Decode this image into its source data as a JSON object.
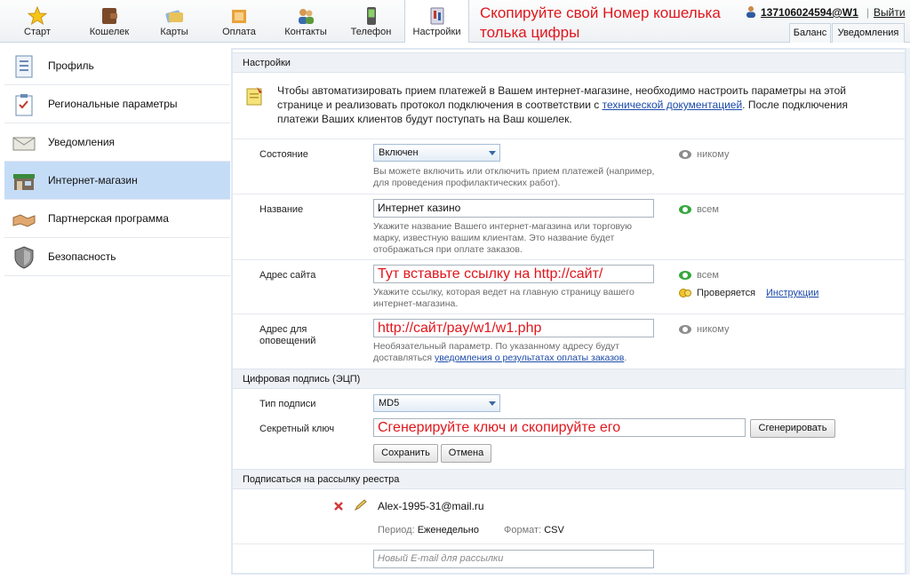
{
  "nav": {
    "tabs": [
      {
        "label": "Старт",
        "icon": "star-icon"
      },
      {
        "label": "Кошелек",
        "icon": "wallet-icon"
      },
      {
        "label": "Карты",
        "icon": "cards-icon"
      },
      {
        "label": "Оплата",
        "icon": "payment-icon"
      },
      {
        "label": "Контакты",
        "icon": "contacts-icon"
      },
      {
        "label": "Телефон",
        "icon": "phone-icon"
      },
      {
        "label": "Настройки",
        "icon": "settings-icon"
      }
    ],
    "active_tab": "Настройки"
  },
  "annotations": {
    "top_line1": "Скопируйте свой Номер кошелька",
    "top_line2": "толька цифры"
  },
  "account": {
    "id": "137106024594@W1",
    "separator": "|",
    "logout": "Выйти",
    "balance_tab": "Баланс",
    "notifications_tab": "Уведомления"
  },
  "sidebar": {
    "items": [
      {
        "label": "Профиль",
        "icon": "profile-icon"
      },
      {
        "label": "Региональные параметры",
        "icon": "regional-icon"
      },
      {
        "label": "Уведомления",
        "icon": "notifications-icon"
      },
      {
        "label": "Интернет-магазин",
        "icon": "shop-icon"
      },
      {
        "label": "Партнерская программа",
        "icon": "handshake-icon"
      },
      {
        "label": "Безопасность",
        "icon": "shield-icon"
      }
    ],
    "active": "Интернет-магазин"
  },
  "settings": {
    "header": "Настройки",
    "intro_part1": "Чтобы автоматизировать прием платежей в Вашем интернет-магазине, необходимо настроить параметры на этой странице и реализовать протокол подключения в соответствии с ",
    "intro_link": "технической документацией",
    "intro_part2": ". После подключения платежи Ваших клиентов будут поступать на Ваш кошелек.",
    "state": {
      "label": "Состояние",
      "value": "Включен",
      "hint": "Вы можете включить или отключить прием платежей (например, для проведения профилактических работ).",
      "visibility": "никому"
    },
    "name": {
      "label": "Название",
      "value": "Интернет казино",
      "hint": "Укажите название Вашего интернет-магазина или торговую марку, известную вашим клиентам. Это название будет отображаться при оплате заказов.",
      "visibility": "всем"
    },
    "site": {
      "label": "Адрес сайта",
      "value": "Тут вставьте ссылку на http://сайт/",
      "hint": "Укажите ссылку, которая ведет на главную страницу вашего интернет-магазина.",
      "visibility": "всем",
      "status": "Проверяется",
      "instructions": "Инструкции"
    },
    "notify": {
      "label_line1": "Адрес для",
      "label_line2": "оповещений",
      "value": "http://сайт/pay/w1/w1.php",
      "hint_part1": "Необязательный параметр. По указанному адресу будут доставляться ",
      "hint_link": "уведомления о результатах оплаты заказов",
      "hint_part2": ".",
      "visibility": "никому"
    }
  },
  "signature": {
    "header": "Цифровая подпись (ЭЦП)",
    "type_label": "Тип подписи",
    "type_value": "MD5",
    "key_label": "Секретный ключ",
    "key_value": "Сгенерируйте ключ и скопируйте его",
    "generate_button": "Сгенерировать",
    "save_button": "Сохранить",
    "cancel_button": "Отмена"
  },
  "subscription": {
    "header": "Подписаться на рассылку реестра",
    "email": "Alex-1995-31@mail.ru",
    "period_label": "Период:",
    "period_value": "Еженедельно",
    "format_label": "Формат:",
    "format_value": "CSV",
    "new_email_placeholder": "Новый E-mail для рассылки"
  },
  "colors": {
    "accent_red": "#e0161c",
    "link_blue": "#1b4aa8",
    "active_sidebar": "#c5dcf7",
    "visible_green": "#34a83c"
  }
}
